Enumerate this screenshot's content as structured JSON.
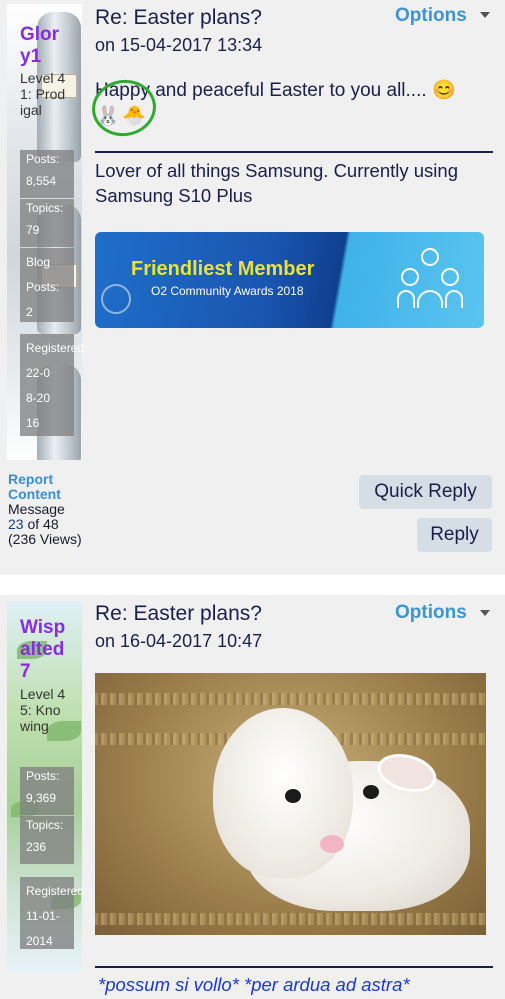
{
  "post1": {
    "author": {
      "username": "Glory1",
      "rank": "Level 41: Prodigal",
      "stats": [
        {
          "label": "Posts:",
          "value": "8,554"
        },
        {
          "label": "Topics:",
          "value": "79"
        },
        {
          "label": "Blog Posts:",
          "value": "2"
        },
        {
          "label": "Registered:",
          "value": "22-08-2016"
        }
      ]
    },
    "subject": "Re: Easter plans?",
    "date": "on 15-04-2017 13:34",
    "options_label": "Options",
    "body": "Happy and peaceful Easter to you all....",
    "body_emojis": [
      "😊",
      "🐰",
      "🐣"
    ],
    "signature": "Lover of all things Samsung. Currently using Samsung S10 Plus",
    "banner": {
      "title": "Friendliest Member",
      "subtitle": "O2 Community Awards 2018"
    },
    "meta": {
      "report_label": "Report Content",
      "message_prefix": "Message",
      "message_number": "23",
      "message_of": "of 48",
      "views": "(236 Views)"
    },
    "quick_reply_label": "Quick Reply",
    "reply_label": "Reply"
  },
  "post2": {
    "author": {
      "username": "Wispalted7",
      "rank": "Level 45: Knowing",
      "stats": [
        {
          "label": "Posts:",
          "value": "9,369"
        },
        {
          "label": "Topics:",
          "value": "236"
        },
        {
          "label": "Registered:",
          "value": "11-01-2014"
        }
      ]
    },
    "subject": "Re: Easter plans?",
    "date": "on 16-04-2017 10:47",
    "options_label": "Options",
    "signature": "*possum si vollo* *per ardua ad astra*"
  },
  "colors": {
    "accent": "#3a95d6",
    "username": "#8a2be2",
    "text": "#1a1f4a",
    "button_bg": "#d5dde5",
    "signature_link": "#1a3ad0",
    "highlight_circle": "#2eaa2e"
  }
}
